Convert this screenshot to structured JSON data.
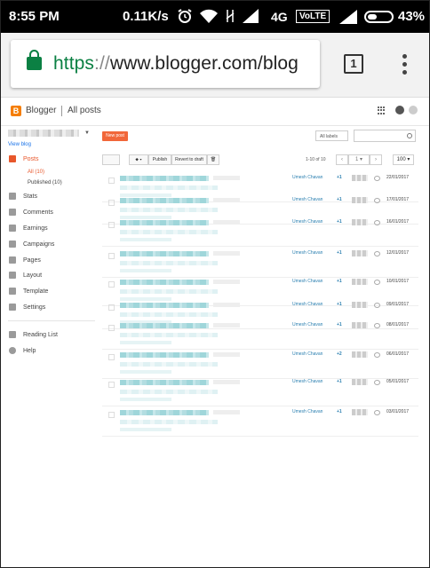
{
  "status_bar": {
    "time": "8:55 PM",
    "speed": "0.11K/s",
    "network": "4G",
    "volte": "VoLTE",
    "battery": "43%",
    "icons": [
      "alarm-icon",
      "wifi-icon",
      "no-data-icon",
      "signal-icon",
      "signal-icon",
      "battery-icon"
    ]
  },
  "browser": {
    "url_scheme": "https",
    "url_sep": "://",
    "url_host": "www.blogger.com/blog",
    "tab_count": "1"
  },
  "blogger": {
    "brand": "Blogger",
    "page_title": "All posts",
    "view_blog": "View blog",
    "new_post": "New post",
    "labels_select": "All labels",
    "toolbar": {
      "publish": "Publish",
      "revert": "Revert to draft"
    },
    "pagination": {
      "info": "1-10 of 10",
      "page": "1",
      "per_page": "100"
    }
  },
  "sidebar": {
    "posts": "Posts",
    "sub": [
      "All (10)",
      "Published (10)"
    ],
    "items": [
      "Stats",
      "Comments",
      "Earnings",
      "Campaigns",
      "Pages",
      "Layout",
      "Template",
      "Settings"
    ],
    "extra": [
      "Reading List",
      "Help"
    ]
  },
  "posts": [
    {
      "author": "Umesh Chavan",
      "comments": "+1",
      "date": "22/01/2017"
    },
    {
      "author": "Umesh Chavan",
      "comments": "+1",
      "date": "17/01/2017"
    },
    {
      "author": "Umesh Chavan",
      "comments": "+1",
      "date": "16/01/2017"
    },
    {
      "author": "Umesh Chavan",
      "comments": "+1",
      "date": "12/01/2017"
    },
    {
      "author": "Umesh Chavan",
      "comments": "+1",
      "date": "10/01/2017"
    },
    {
      "author": "Umesh Chavan",
      "comments": "+1",
      "date": "09/01/2017"
    },
    {
      "author": "Umesh Chavan",
      "comments": "+1",
      "date": "08/01/2017"
    },
    {
      "author": "Umesh Chavan",
      "comments": "+2",
      "date": "06/01/2017"
    },
    {
      "author": "Umesh Chavan",
      "comments": "+1",
      "date": "05/01/2017"
    },
    {
      "author": "Umesh Chavan",
      "comments": "+1",
      "date": "03/01/2017"
    }
  ],
  "colors": {
    "accent": "#e8572b",
    "link": "#2a7fb0",
    "secure": "#0b8043"
  }
}
